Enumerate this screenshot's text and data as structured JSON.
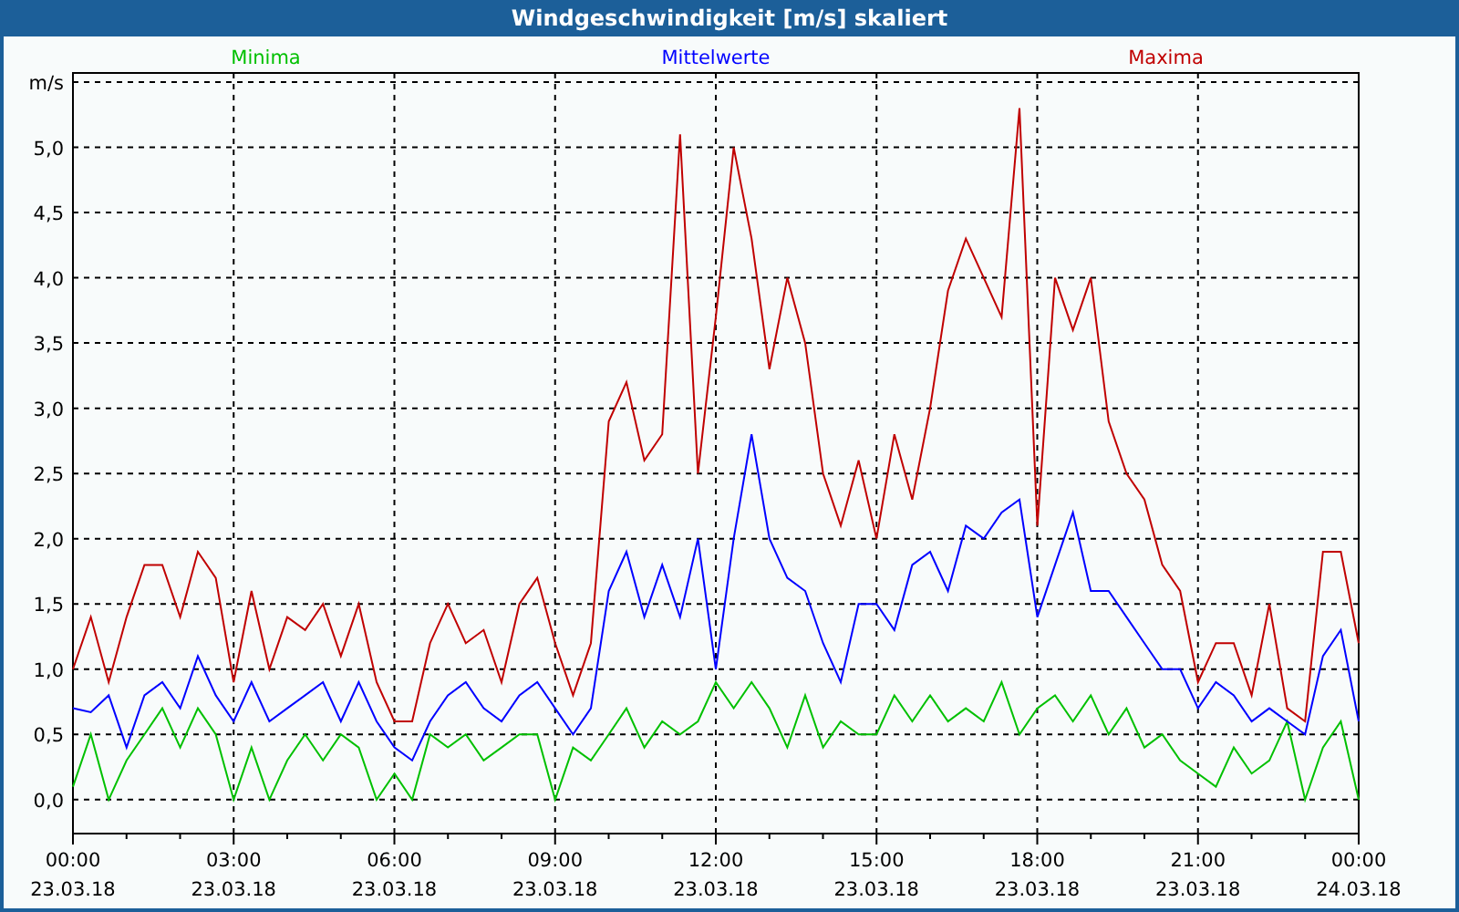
{
  "window": {
    "title": "Windgeschwindigkeit [m/s] skaliert"
  },
  "chart": {
    "chart_data": {
      "type": "line",
      "categories": [
        "00:00\n23.03.18",
        null,
        null,
        null,
        null,
        null,
        null,
        null,
        null,
        "03:00\n23.03.18",
        null,
        null,
        null,
        null,
        null,
        null,
        null,
        null,
        "06:00\n23.03.18",
        null,
        null,
        null,
        null,
        null,
        null,
        null,
        null,
        "09:00\n23.03.18",
        null,
        null,
        null,
        null,
        null,
        null,
        null,
        null,
        "12:00\n23.03.18",
        null,
        null,
        null,
        null,
        null,
        null,
        null,
        null,
        "15:00\n23.03.18",
        null,
        null,
        null,
        null,
        null,
        null,
        null,
        null,
        "18:00\n23.03.18",
        null,
        null,
        null,
        null,
        null,
        null,
        null,
        null,
        "21:00\n23.03.18",
        null,
        null,
        null,
        null,
        null,
        null,
        null,
        null,
        "00:00\n24.03.18"
      ],
      "series": [
        {
          "name": "Minima",
          "color": "#00c000",
          "values": [
            0.1,
            0.5,
            0,
            0.3,
            0.5,
            0.7,
            0.4,
            0.7,
            0.5,
            0,
            0.4,
            0,
            0.3,
            0.5,
            0.3,
            0.5,
            0.4,
            0,
            0.2,
            0,
            0.5,
            0.4,
            0.5,
            0.3,
            0.4,
            0.5,
            0.5,
            0,
            0.4,
            0.3,
            0.5,
            0.7,
            0.4,
            0.6,
            0.5,
            0.6,
            0.9,
            0.7,
            0.9,
            0.7,
            0.4,
            0.8,
            0.4,
            0.6,
            0.5,
            0.5,
            0.8,
            0.6,
            0.8,
            0.6,
            0.7,
            0.6,
            0.9,
            0.5,
            0.7,
            0.8,
            0.6,
            0.8,
            0.5,
            0.7,
            0.4,
            0.5,
            0.3,
            0.2,
            0.1,
            0.4,
            0.2,
            0.3,
            0.6,
            0,
            0.4,
            0.6,
            0
          ]
        },
        {
          "name": "Mittelwerte",
          "color": "#0000ff",
          "values": [
            0.7,
            0.67,
            0.8,
            0.4,
            0.8,
            0.9,
            0.7,
            1.1,
            0.8,
            0.6,
            0.9,
            0.6,
            0.7,
            0.8,
            0.9,
            0.6,
            0.9,
            0.6,
            0.4,
            0.3,
            0.6,
            0.8,
            0.9,
            0.7,
            0.6,
            0.8,
            0.9,
            0.7,
            0.5,
            0.7,
            1.6,
            1.9,
            1.4,
            1.8,
            1.4,
            2,
            1,
            2,
            2.8,
            2,
            1.7,
            1.6,
            1.2,
            0.9,
            1.5,
            1.5,
            1.3,
            1.8,
            1.9,
            1.6,
            2.1,
            2,
            2.2,
            2.3,
            1.4,
            1.8,
            2.2,
            1.6,
            1.6,
            1.4,
            1.2,
            1,
            1,
            0.7,
            0.9,
            0.8,
            0.6,
            0.7,
            0.6,
            0.5,
            1.1,
            1.3,
            0.6
          ]
        },
        {
          "name": "Maxima",
          "color": "#c00000",
          "values": [
            1,
            1.4,
            0.9,
            1.4,
            1.8,
            1.8,
            1.4,
            1.9,
            1.7,
            0.9,
            1.6,
            1,
            1.4,
            1.3,
            1.5,
            1.1,
            1.5,
            0.9,
            0.6,
            0.6,
            1.2,
            1.5,
            1.2,
            1.3,
            0.9,
            1.5,
            1.7,
            1.2,
            0.8,
            1.2,
            2.9,
            3.2,
            2.6,
            2.8,
            5.1,
            2.5,
            3.7,
            5,
            4.3,
            3.3,
            4,
            3.5,
            2.5,
            2.1,
            2.6,
            2,
            2.8,
            2.3,
            3,
            3.9,
            4.3,
            4,
            3.7,
            5.3,
            2.1,
            4,
            3.6,
            4,
            2.9,
            2.5,
            2.3,
            1.8,
            1.6,
            0.9,
            1.2,
            1.2,
            0.8,
            1.5,
            0.7,
            0.6,
            1.9,
            1.9,
            1.2
          ]
        }
      ],
      "ylim": [
        -0.26,
        5.57
      ],
      "grid": true,
      "yticks": [
        {
          "value": 0,
          "label": "0,0"
        },
        {
          "value": 0.5,
          "label": "0,5"
        },
        {
          "value": 1,
          "label": "1,0"
        },
        {
          "value": 1.5,
          "label": "1,5"
        },
        {
          "value": 2,
          "label": "2,0"
        },
        {
          "value": 2.5,
          "label": "2,5"
        },
        {
          "value": 3,
          "label": "3,0"
        },
        {
          "value": 3.5,
          "label": "3,5"
        },
        {
          "value": 4,
          "label": "4,0"
        },
        {
          "value": 4.5,
          "label": "4,5"
        },
        {
          "value": 5,
          "label": "5,0"
        },
        {
          "value": 5.5,
          "label": "m/s"
        }
      ]
    }
  }
}
